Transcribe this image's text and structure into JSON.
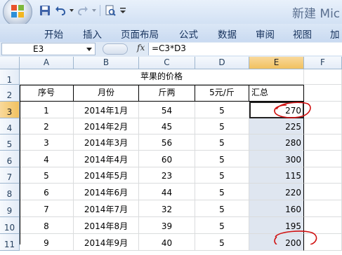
{
  "window": {
    "title": "新建 Mic"
  },
  "quick_access": {
    "icons": [
      "save-icon",
      "undo-icon",
      "redo-icon",
      "print-preview-icon",
      "customize-dropdown-icon"
    ]
  },
  "ribbon": {
    "tabs": [
      "开始",
      "插入",
      "页面布局",
      "公式",
      "数据",
      "审阅",
      "视图",
      "加"
    ]
  },
  "formula_bar": {
    "name_box": "E3",
    "fx": "fx",
    "formula": "=C3*D3"
  },
  "sheet": {
    "columns": [
      "A",
      "B",
      "C",
      "D",
      "E",
      "F"
    ],
    "rows": [
      "1",
      "2",
      "3",
      "4",
      "5",
      "6",
      "7",
      "8",
      "9",
      "10",
      "11"
    ],
    "title": "苹果的价格",
    "headers": [
      "序号",
      "月份",
      "斤两",
      "5元/斤",
      "汇总"
    ],
    "data": [
      [
        "1",
        "2014年1月",
        "54",
        "5",
        "270"
      ],
      [
        "2",
        "2014年2月",
        "45",
        "5",
        "225"
      ],
      [
        "3",
        "2014年3月",
        "56",
        "5",
        "280"
      ],
      [
        "4",
        "2014年4月",
        "60",
        "5",
        "300"
      ],
      [
        "5",
        "2014年5月",
        "23",
        "5",
        "115"
      ],
      [
        "6",
        "2014年6月",
        "44",
        "5",
        "220"
      ],
      [
        "7",
        "2014年7月",
        "32",
        "5",
        "160"
      ],
      [
        "8",
        "2014年8月",
        "39",
        "5",
        "195"
      ],
      [
        "9",
        "2014年9月",
        "40",
        "5",
        "200"
      ]
    ]
  },
  "colors": {
    "active_header": "#f1c15f",
    "annotation": "#d01010",
    "selection_shade": "#dfe6f0"
  }
}
